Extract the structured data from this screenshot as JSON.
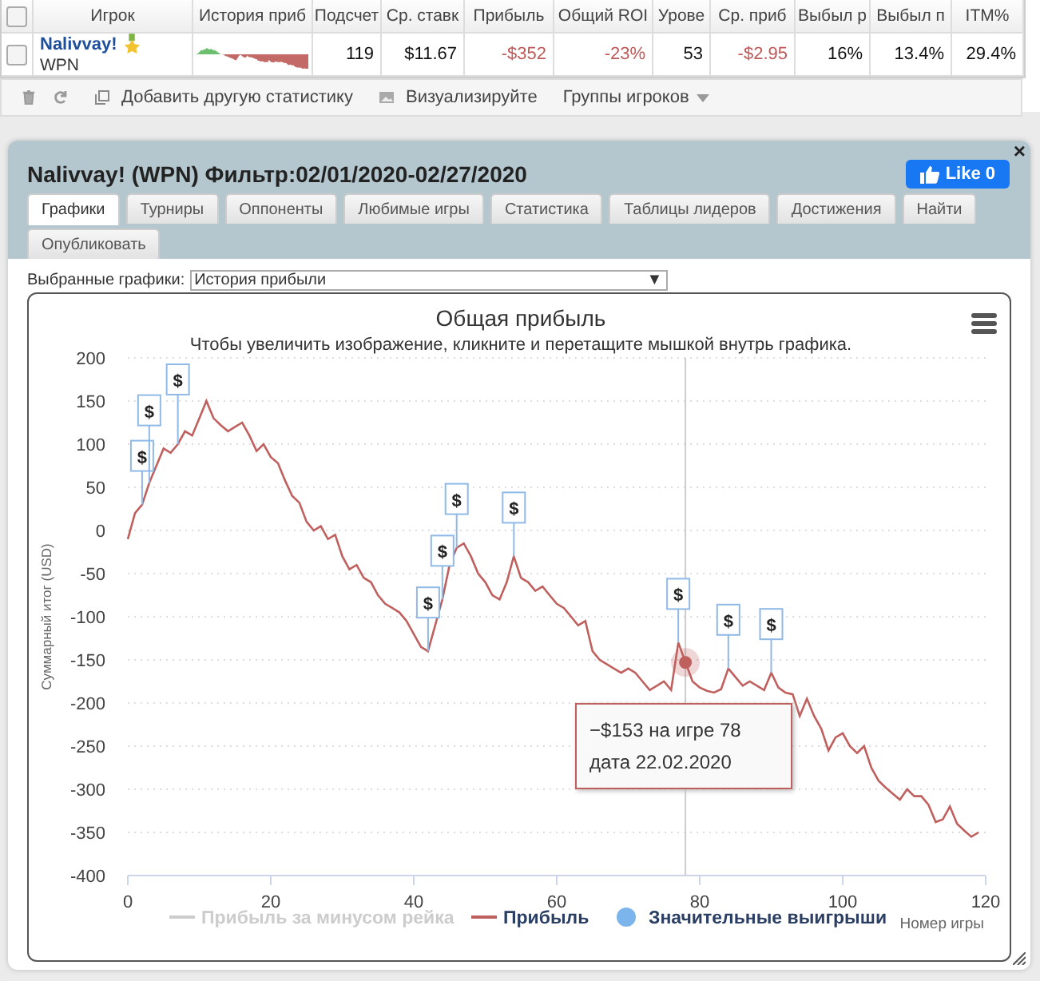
{
  "stats_table": {
    "header_checkbox": {
      "checked": false
    },
    "columns": [
      "Игрок",
      "История приб",
      "Подсчет",
      "Ср. ставк",
      "Прибыль",
      "Общий ROI",
      "Урове",
      "Ср. приб",
      "Выбыл р",
      "Выбыл п",
      "ITM%"
    ],
    "rows": [
      {
        "checked": false,
        "cells": [
          {
            "kind": "player",
            "text": "Nalivvay!",
            "subtext": "WPN"
          },
          {
            "kind": "picture"
          },
          {
            "kind": "value",
            "text": "119",
            "negative": false
          },
          {
            "kind": "value",
            "text": "$11.67",
            "negative": false
          },
          {
            "kind": "value",
            "text": "-$352",
            "negative": true
          },
          {
            "kind": "value",
            "text": "-23%",
            "negative": true
          },
          {
            "kind": "value",
            "text": "53",
            "negative": false
          },
          {
            "kind": "value",
            "text": "-$2.95",
            "negative": true
          },
          {
            "kind": "value",
            "text": "16%",
            "negative": false
          },
          {
            "kind": "value",
            "text": "13.4%",
            "negative": false
          },
          {
            "kind": "value",
            "text": "29.4%",
            "negative": false
          }
        ]
      }
    ]
  },
  "toolbar": [
    {
      "kind": "trash"
    },
    {
      "kind": "refresh"
    },
    {
      "kind": "add",
      "label": "Добавить другую статистику"
    },
    {
      "kind": "image",
      "label": "Визуализируйте"
    },
    {
      "kind": "dropdown",
      "label": "Группы игроков"
    }
  ],
  "dialog": {
    "title": "Nalivvay! (WPN) Фильтр:02/01/2020-02/27/2020",
    "like_button": "Like 0",
    "close": "×",
    "tabs": [
      {
        "label": "Графики",
        "selected": true
      },
      {
        "label": "Турниры",
        "selected": false
      },
      {
        "label": "Оппоненты",
        "selected": false
      },
      {
        "label": "Любимые игры",
        "selected": false
      },
      {
        "label": "Статистика",
        "selected": false
      },
      {
        "label": "Таблицы лидеров",
        "selected": false
      },
      {
        "label": "Достижения",
        "selected": false
      },
      {
        "label": "Найти",
        "selected": false
      },
      {
        "label": "Опубликовать",
        "selected": false
      }
    ],
    "chart_selector": {
      "label": "Выбранные графики:",
      "value": "История прибыли",
      "arrow": "▼"
    },
    "chart": {
      "hint": "Чтобы увеличить изображение, кликните и перетащите мышкой внутрь графика.",
      "tooltip": "−$153 на игре 78 дата 22.02.2020",
      "legend": [
        {
          "label": "Прибыль за минусом рейка",
          "kind": "line",
          "enabled": false
        },
        {
          "kind": "series",
          "enabled": true
        },
        {
          "label": "Значительные выигрыши",
          "kind": "dot",
          "enabled": true
        }
      ],
      "chart_data": {
        "type": "line",
        "title": "Общая прибыль",
        "xlabel": "Номер игры",
        "ylabel": "Суммарный итог (USD)",
        "grid": true,
        "xlim": [
          0,
          120
        ],
        "ylim": [
          -400,
          200
        ],
        "xticks": [
          0,
          20,
          40,
          60,
          80,
          100,
          120
        ],
        "yticks": [
          -400,
          -350,
          -300,
          -250,
          -200,
          -150,
          -100,
          -50,
          0,
          50,
          100,
          150,
          200
        ],
        "x": [
          0,
          1,
          2,
          3,
          4,
          5,
          6,
          7,
          8,
          9,
          10,
          11,
          12,
          13,
          14,
          15,
          16,
          17,
          18,
          19,
          20,
          21,
          22,
          23,
          24,
          25,
          26,
          27,
          28,
          29,
          30,
          31,
          32,
          33,
          34,
          35,
          36,
          37,
          38,
          39,
          40,
          41,
          42,
          43,
          44,
          45,
          46,
          47,
          48,
          49,
          50,
          51,
          52,
          53,
          54,
          55,
          56,
          57,
          58,
          59,
          60,
          61,
          62,
          63,
          64,
          65,
          66,
          67,
          68,
          69,
          70,
          71,
          72,
          73,
          74,
          75,
          76,
          77,
          78,
          79,
          80,
          81,
          82,
          83,
          84,
          85,
          86,
          87,
          88,
          89,
          90,
          91,
          92,
          93,
          94,
          95,
          96,
          97,
          98,
          99,
          100,
          101,
          102,
          103,
          104,
          105,
          106,
          107,
          108,
          109,
          110,
          111,
          112,
          113,
          114,
          115,
          116,
          117,
          118,
          119
        ],
        "series": [
          {
            "name": "Прибыль",
            "color": "#c0605e",
            "values": [
              -10,
              20,
              30,
              55,
              75,
              95,
              90,
              100,
              115,
              110,
              130,
              150,
              130,
              122,
              115,
              120,
              125,
              110,
              92,
              100,
              85,
              78,
              58,
              40,
              32,
              10,
              0,
              5,
              -10,
              -5,
              -30,
              -45,
              -40,
              -55,
              -60,
              -75,
              -85,
              -90,
              -95,
              -105,
              -120,
              -135,
              -140,
              -110,
              -80,
              -40,
              -20,
              -15,
              -30,
              -50,
              -60,
              -75,
              -80,
              -60,
              -30,
              -55,
              -60,
              -70,
              -65,
              -75,
              -85,
              -90,
              -100,
              -110,
              -105,
              -140,
              -150,
              -155,
              -160,
              -165,
              -160,
              -165,
              -175,
              -185,
              -180,
              -175,
              -185,
              -130,
              -153,
              -175,
              -182,
              -186,
              -188,
              -184,
              -160,
              -170,
              -180,
              -175,
              -180,
              -185,
              -165,
              -182,
              -188,
              -190,
              -215,
              -195,
              -215,
              -230,
              -255,
              -240,
              -235,
              -250,
              -258,
              -250,
              -275,
              -290,
              -298,
              -305,
              -312,
              -300,
              -308,
              -308,
              -318,
              -338,
              -335,
              -320,
              -340,
              -348,
              -355,
              -350
            ]
          }
        ],
        "ref_lines": [
          {
            "axis": "x",
            "value": 78,
            "color": "#cccccc"
          }
        ],
        "annotations": [
          {
            "x": 2,
            "y": 30,
            "text": "$"
          },
          {
            "x": 3,
            "y": 55,
            "text": "$"
          },
          {
            "x": 7,
            "y": 100,
            "text": "$"
          },
          {
            "x": 42,
            "y": -140,
            "text": "$"
          },
          {
            "x": 44,
            "y": -80,
            "text": "$"
          },
          {
            "x": 46,
            "y": -20,
            "text": "$"
          },
          {
            "x": 54,
            "y": -30,
            "text": "$"
          },
          {
            "x": 77,
            "y": -130,
            "text": "$"
          },
          {
            "x": 84,
            "y": -160,
            "text": "$"
          },
          {
            "x": 90,
            "y": -165,
            "text": "$"
          }
        ]
      }
    }
  }
}
